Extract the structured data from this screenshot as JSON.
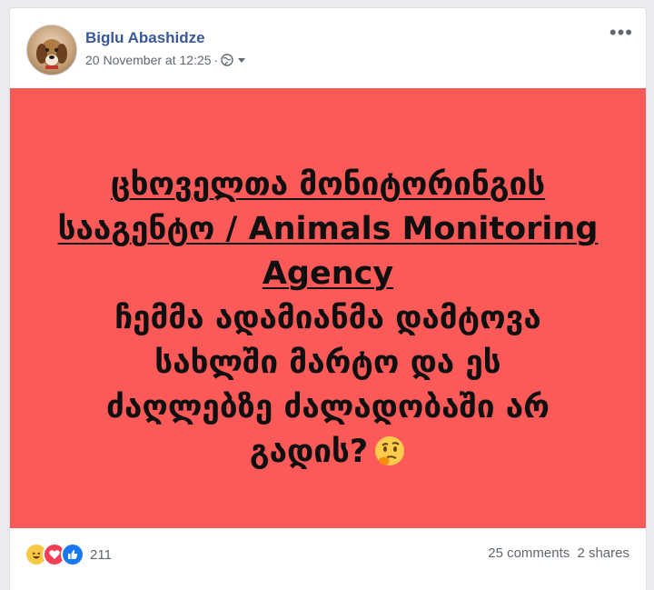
{
  "post": {
    "author": "Biglu Abashidze",
    "timestamp": "20 November at 12:25",
    "separator": "·",
    "privacy_icon": "globe-icon",
    "dropdown_icon": "caret-down-icon",
    "more_label": "•••",
    "banner": {
      "background": "#fb5a59",
      "line1": "ცხოველთა მონიტორინგის",
      "line2": "სააგენტო / Animals Monitoring",
      "line3": "Agency",
      "line4": "ჩემმა ადამიანმა დამტოვა",
      "line5": "სახლში მარტო და ეს",
      "line6": "ძაღლებზე ძალადობაში არ",
      "line7": "გადის?",
      "emoji": "thinking-face-emoji"
    },
    "reactions": {
      "icons": [
        "haha-icon",
        "love-icon",
        "like-icon"
      ],
      "count": "211"
    },
    "comments": "25 comments",
    "shares": "2 shares"
  }
}
